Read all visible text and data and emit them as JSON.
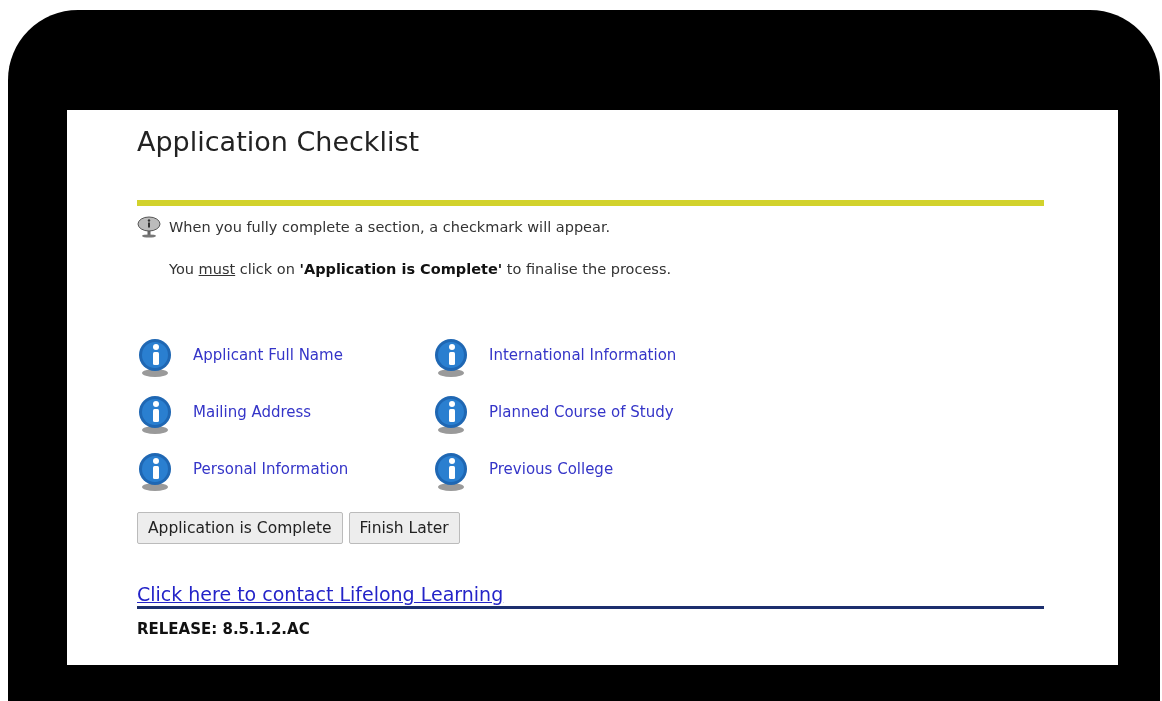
{
  "title": "Application Checklist",
  "notes": [
    {
      "kind": "icon",
      "parts": [
        {
          "kind": "plain",
          "text": "When you fully complete a section, a checkmark will appear."
        }
      ]
    },
    {
      "kind": "plain",
      "parts": [
        {
          "kind": "plain",
          "text": "You "
        },
        {
          "kind": "underline",
          "text": "must"
        },
        {
          "kind": "plain",
          "text": " click on "
        },
        {
          "kind": "bold",
          "text": "'Application is Complete'"
        },
        {
          "kind": "plain",
          "text": " to finalise the process."
        }
      ]
    }
  ],
  "sections": [
    {
      "label": "Applicant Full Name"
    },
    {
      "label": "International Information"
    },
    {
      "label": "Mailing Address"
    },
    {
      "label": "Planned Course of Study"
    },
    {
      "label": "Personal Information"
    },
    {
      "label": "Previous College"
    }
  ],
  "buttons": [
    "Application is Complete",
    "Finish Later"
  ],
  "contact_link": "Click here to contact Lifelong Learning",
  "release": "RELEASE: 8.5.1.2.AC"
}
